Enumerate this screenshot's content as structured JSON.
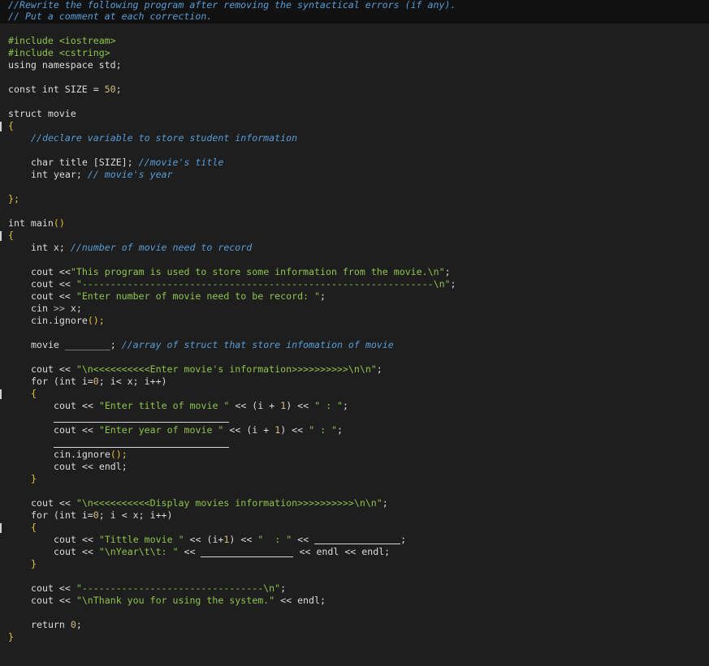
{
  "header": {
    "line1": "//Rewrite the following program after removing the syntactical errors (if any).",
    "line2": "// Put a comment at each correction."
  },
  "code": {
    "include_kw1": "#include",
    "include_lib1": "<iostream>",
    "include_kw2": "#include",
    "include_lib2": "<cstring>",
    "using_line": "using namespace std;",
    "const_prefix": "const int SIZE = ",
    "const_value": "50",
    "const_suffix": ";",
    "struct_line": "struct movie",
    "open_brace": "{",
    "struct_comment": "//declare variable to store student information",
    "char_decl": "char title [SIZE];",
    "char_comment": " //movie's title",
    "int_decl": "int year;",
    "int_comment": " // movie's year",
    "struct_close": "};",
    "main_sig": "int main",
    "main_parens": "()",
    "main_open": "{",
    "int_x_decl": "int x;",
    "int_x_comment": " //number of movie need to record",
    "cout1_a": "cout <<",
    "cout1_str": "\"This program is used to store some information from the movie.\\n\"",
    "cout1_end": ";",
    "cout2_a": "cout << ",
    "cout2_str": "\"--------------------------------------------------------------\\n\"",
    "cout2_end": ";",
    "cout3_a": "cout << ",
    "cout3_str": "\"Enter number of movie need to be record: \"",
    "cout3_end": ";",
    "cin_line_a": "cin ",
    "cin_line_op": ">>",
    "cin_line_b": " x;",
    "cin_ignore_a": "cin.ignore",
    "cin_ignore_b": "();",
    "movie_decl": "movie ",
    "movie_blank": "________",
    "movie_semi": ";",
    "movie_comment": " //array of struct that store infomation of movie",
    "cout4_a": "cout << ",
    "cout4_str": "\"\\n<<<<<<<<<<Enter movie's information>>>>>>>>>>\\n\\n\"",
    "cout4_end": ";",
    "for1_a": "for ",
    "for1_b": "(int i=",
    "for1_n": "0",
    "for1_c": "; i< x; i++)",
    "for1_open": "{",
    "cout5_a": "cout << ",
    "cout5_str": "\"Enter title of movie \"",
    "cout5_b": " << (i + ",
    "cout5_n": "1",
    "cout5_c": ") << ",
    "cout5_str2": "\" : \"",
    "cout5_end": ";",
    "cout6_a": "cout << ",
    "cout6_str": "\"Enter year of movie \"",
    "cout6_b": " << (i + ",
    "cout6_n": "1",
    "cout6_c": ") << ",
    "cout6_str2": "\" : \"",
    "cout6_end": ";",
    "cin_ignore2_a": "cin.ignore",
    "cin_ignore2_b": "();",
    "cout_endl": "cout << endl;",
    "for1_close": "}",
    "cout7_a": "cout << ",
    "cout7_str": "\"\\n<<<<<<<<<<Display movies information>>>>>>>>>>\\n\\n\"",
    "cout7_end": ";",
    "for2_a": "for ",
    "for2_b": "(int i=",
    "for2_n": "0",
    "for2_c": "; i < x; i++)",
    "for2_open": "{",
    "cout8_a": "cout << ",
    "cout8_str": "\"Tittle movie \"",
    "cout8_b": " << (i+",
    "cout8_n": "1",
    "cout8_c": ") << ",
    "cout8_str2": "\"  : \"",
    "cout8_d": " << ",
    "cout8_end": ";",
    "cout9_a": "cout << ",
    "cout9_str": "\"\\nYear\\t\\t: \"",
    "cout9_b": " << ",
    "cout9_c": " << endl << endl;",
    "for2_close": "}",
    "cout10_a": "cout << ",
    "cout10_str": "\"--------------------------------\\n\"",
    "cout10_end": ";",
    "cout11_a": "cout << ",
    "cout11_str": "\"\\nThank you for using the system.\"",
    "cout11_b": " << endl;",
    "return_a": "return ",
    "return_n": "0",
    "return_end": ";",
    "main_close": "}"
  },
  "colors": {
    "background": "#1e1e1e",
    "header_band": "#111111",
    "comment_blue": "#569cd6",
    "string_green": "#8dc44a",
    "number": "#d7ba7d",
    "bracket": "#e8c12c"
  }
}
